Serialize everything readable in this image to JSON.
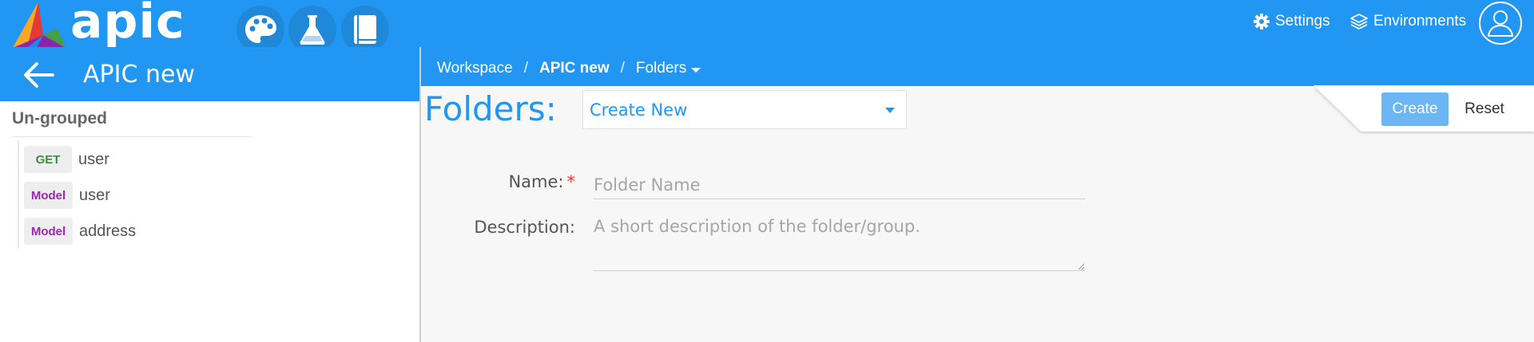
{
  "app": {
    "logo_text": "apic"
  },
  "topbar": {
    "tool_buttons": [
      "palette-icon",
      "flask-icon",
      "book-icon"
    ],
    "settings_label": "Settings",
    "environments_label": "Environments"
  },
  "sidebar": {
    "project_title": "APIC new",
    "group_title": "Un-grouped",
    "items": [
      {
        "badge": "GET",
        "type": "get",
        "label": "user"
      },
      {
        "badge": "Model",
        "type": "model",
        "label": "user"
      },
      {
        "badge": "Model",
        "type": "model",
        "label": "address"
      }
    ]
  },
  "breadcrumb": {
    "items": [
      "Workspace",
      "APIC new",
      "Folders"
    ],
    "separator": "/"
  },
  "main": {
    "title": "Folders:",
    "select_value": "Create New",
    "create_label": "Create",
    "reset_label": "Reset",
    "form": {
      "name_label": "Name:",
      "required_mark": "*",
      "name_placeholder": "Folder Name",
      "description_label": "Description:",
      "description_placeholder": "A short description of the folder/group."
    }
  },
  "colors": {
    "primary": "#2196f3",
    "get_badge": "#388e3c",
    "model_badge": "#9c27b0",
    "create_button": "#6cb6f5"
  }
}
